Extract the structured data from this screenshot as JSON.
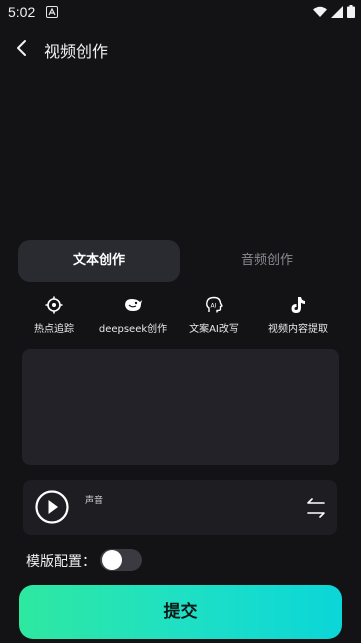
{
  "status_bar": {
    "time": "5:02"
  },
  "header": {
    "title": "视频创作"
  },
  "tabs": [
    {
      "label": "文本创作",
      "active": true
    },
    {
      "label": "音频创作",
      "active": false
    }
  ],
  "tools": [
    {
      "label": "热点追踪",
      "icon": "crosshair-icon"
    },
    {
      "label": "deepseek创作",
      "icon": "deepseek-whale-icon"
    },
    {
      "label": "文案AI改写",
      "icon": "ai-head-icon"
    },
    {
      "label": "视频内容提取",
      "icon": "tiktok-icon"
    }
  ],
  "text_input": {
    "value": ""
  },
  "audio": {
    "voice_label": "声音"
  },
  "template": {
    "label": "模版配置：",
    "enabled": false
  },
  "submit": {
    "label": "提交"
  },
  "colors": {
    "accent_start": "#2ee8a0",
    "accent_end": "#0bd6d8",
    "background": "#131316"
  }
}
